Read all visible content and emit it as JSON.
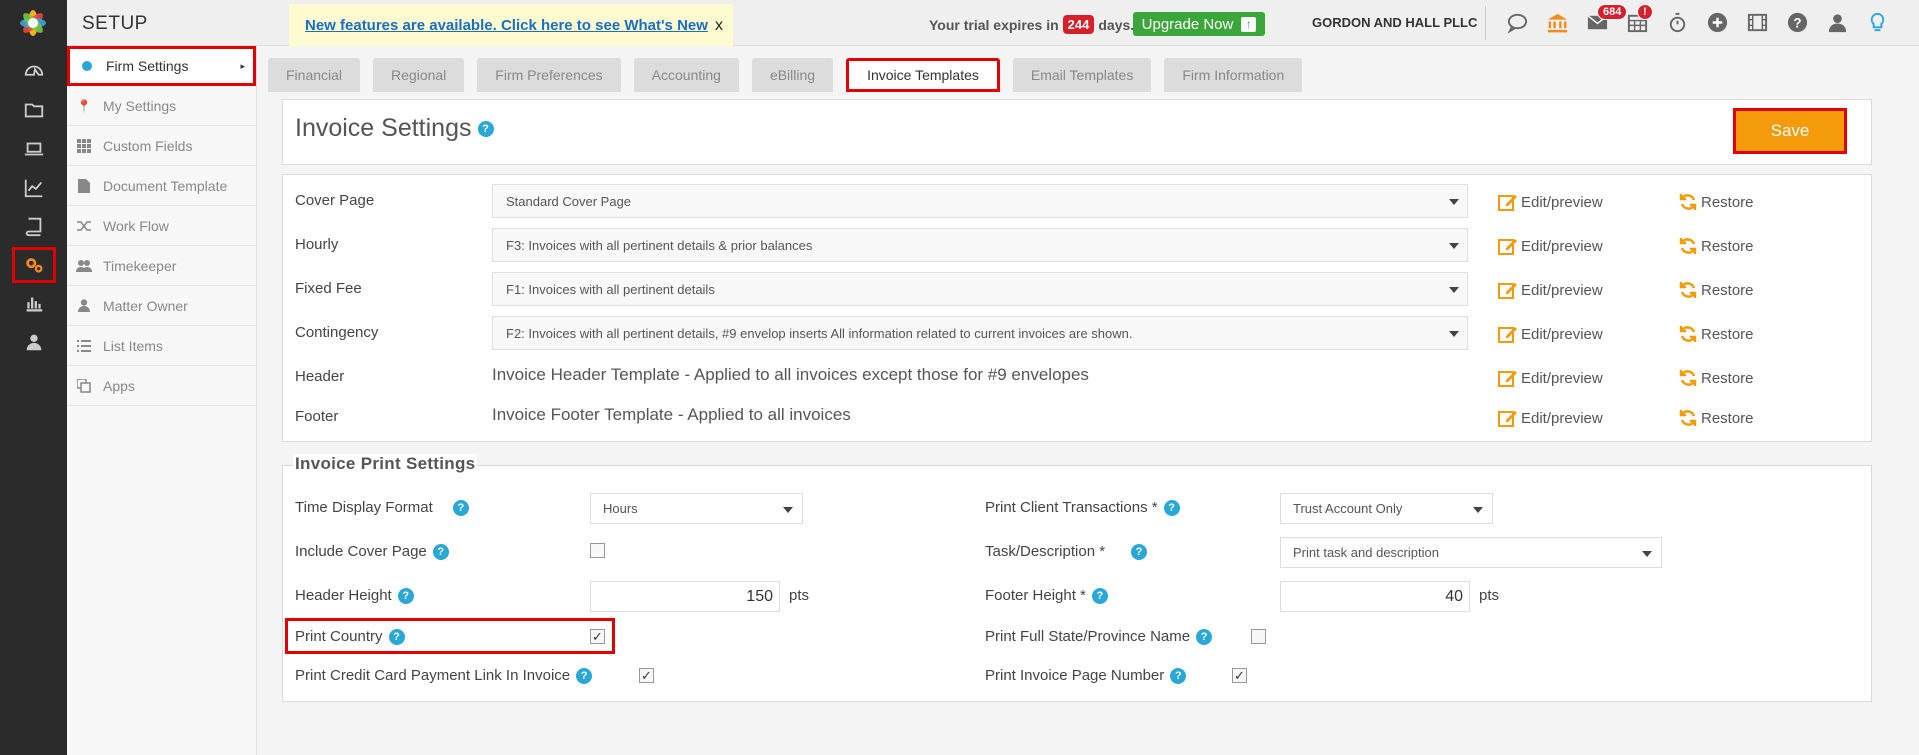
{
  "topbar": {
    "title": "SETUP",
    "notice_link": "New features are available. Click here to see What's New",
    "notice_close": "x",
    "trial_prefix": "Your trial expires in",
    "trial_days": "244",
    "trial_suffix": "days.",
    "upgrade_label": "Upgrade Now",
    "firm_name": "GORDON AND HALL PLLC",
    "mail_badge": "684",
    "calendar_badge": "!"
  },
  "side_menu": {
    "items": [
      {
        "label": "Firm Settings",
        "icon": "dot-icon"
      },
      {
        "label": "My Settings",
        "icon": "pin-icon"
      },
      {
        "label": "Custom Fields",
        "icon": "grid-icon"
      },
      {
        "label": "Document Template",
        "icon": "document-icon"
      },
      {
        "label": "Work Flow",
        "icon": "shuffle-icon"
      },
      {
        "label": "Timekeeper",
        "icon": "users-icon"
      },
      {
        "label": "Matter Owner",
        "icon": "user-icon"
      },
      {
        "label": "List Items",
        "icon": "list-icon"
      },
      {
        "label": "Apps",
        "icon": "copy-icon"
      }
    ]
  },
  "tabs": [
    "Financial",
    "Regional",
    "Firm Preferences",
    "Accounting",
    "eBilling",
    "Invoice Templates",
    "Email Templates",
    "Firm Information"
  ],
  "invoice_settings": {
    "title": "Invoice Settings",
    "save_label": "Save",
    "edit_label": "Edit/preview",
    "restore_label": "Restore",
    "rows": [
      {
        "label": "Cover Page",
        "value": "Standard Cover Page"
      },
      {
        "label": "Hourly",
        "value": "F3: Invoices with all pertinent details & prior balances"
      },
      {
        "label": "Fixed Fee",
        "value": "F1: Invoices with all pertinent details"
      },
      {
        "label": "Contingency",
        "value": "F2: Invoices with all pertinent details, #9 envelop inserts All information related to current invoices are shown."
      },
      {
        "label": "Header",
        "value": "Invoice Header Template - Applied to all invoices except those for #9 envelopes"
      },
      {
        "label": "Footer",
        "value": "Invoice Footer Template - Applied to all invoices"
      }
    ]
  },
  "print_settings": {
    "legend": "Invoice Print Settings",
    "time_display_label": "Time Display Format",
    "time_display_value": "Hours",
    "include_cover_label": "Include Cover Page",
    "include_cover_checked": false,
    "header_height_label": "Header Height",
    "header_height_value": "150",
    "pts": "pts",
    "print_country_label": "Print Country",
    "print_country_checked": true,
    "print_cc_label": "Print Credit Card Payment Link In Invoice",
    "print_cc_checked": true,
    "client_tx_label": "Print Client Transactions *",
    "client_tx_value": "Trust Account Only",
    "task_desc_label": "Task/Description *",
    "task_desc_value": "Print task and description",
    "footer_height_label": "Footer Height *",
    "footer_height_value": "40",
    "full_state_label": "Print Full State/Province Name",
    "full_state_checked": false,
    "page_number_label": "Print Invoice Page Number",
    "page_number_checked": true
  },
  "colors": {
    "accent_orange": "#f59a0b",
    "highlight_red": "#e20000",
    "help_blue": "#29a7d6",
    "upgrade_green": "#3ba73a"
  }
}
